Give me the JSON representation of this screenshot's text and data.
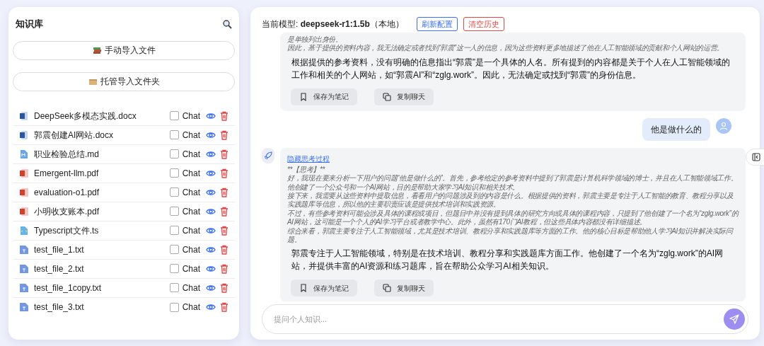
{
  "sidebar": {
    "title": "知识库",
    "import_buttons": [
      {
        "label": "手动导入文件",
        "kind": "books"
      },
      {
        "label": "托管导入文件夹",
        "kind": "box"
      }
    ],
    "files": [
      {
        "name": "DeepSeek多模态实践.docx",
        "kind": "word",
        "chat_label": "Chat",
        "checked": false
      },
      {
        "name": "郭震创建AI网站.docx",
        "kind": "word",
        "chat_label": "Chat",
        "checked": false
      },
      {
        "name": "职业检验总结.md",
        "kind": "md",
        "chat_label": "Chat",
        "checked": false
      },
      {
        "name": "Emergent-llm.pdf",
        "kind": "pdf",
        "chat_label": "Chat",
        "checked": false
      },
      {
        "name": "evaluation-o1.pdf",
        "kind": "pdf",
        "chat_label": "Chat",
        "checked": false
      },
      {
        "name": "小明收支账本.pdf",
        "kind": "pdf",
        "chat_label": "Chat",
        "checked": false
      },
      {
        "name": "Typescript文件.ts",
        "kind": "code",
        "chat_label": "Chat",
        "checked": false
      },
      {
        "name": "test_file_1.txt",
        "kind": "txt",
        "chat_label": "Chat",
        "checked": false
      },
      {
        "name": "test_file_2.txt",
        "kind": "txt",
        "chat_label": "Chat",
        "checked": false
      },
      {
        "name": "test_file_1copy.txt",
        "kind": "txt",
        "chat_label": "Chat",
        "checked": false
      },
      {
        "name": "test_file_3.txt",
        "kind": "txt",
        "chat_label": "Chat",
        "checked": false
      }
    ]
  },
  "chat": {
    "model_line": "当前模型: **deepseek-r1:1.5b**（本地）",
    "header_buttons": [
      {
        "label": "刷新配置",
        "kind": "primary"
      },
      {
        "label": "清空历史",
        "kind": "danger"
      }
    ],
    "messages": [
      {
        "kind": "bot",
        "thinking": [
          "是单独列出身份。",
          "因此，基于提供的资料内容，我无法确定或者找到“郭震”这一人的信息，因为这些资料更多地描述了他在人工智能领域的贡献和个人网站的运营。"
        ],
        "answer": "根据提供的参考资料，没有明确的信息指出“郭震”是一个具体的人名。所有提到的内容都是关于个人在人工智能领域的工作和相关的个人网站，如“郭震AI”和“zglg.work”。因此，无法确定或找到“郭震”的身份信息。",
        "actions": [
          {
            "label": "保存为笔记",
            "kind": "bookmark"
          },
          {
            "label": "复制聊天",
            "kind": "copy"
          }
        ]
      },
      {
        "kind": "user",
        "text": "他是做什么的"
      },
      {
        "kind": "bot",
        "toggle": "隐藏思考过程",
        "thinking": [
          "**【思考】**",
          "好，我现在要来分析一下用户的问题“他是做什么的”。首先，参考给定的参考资料中提到了郭震是计算机科学领域的博士，并且在人工智能领域工作。他创建了一个公众号和一个AI网站，目的是帮助大家学习AI知识和相关技术。",
          "接下来，我需要从这些资料中提取信息，看看用户的问题涉及到的内容是什么。根据提供的资料，郭震主要是专注于人工智能的教育、教程分享以及实践题库等信息，所以他的主要职责应该是提供技术培训和实践资源。",
          "不过，有些参考资料可能会涉及具体的课程或项目，但题目中并没有提到具体的研究方向或具体的课程内容，只提到了他创建了一个名为“zglg.work”的AI网站，这可能是一个个人的AI学习平台或者教学中心。此外，虽然有170门AI教程，但这些具体内容都没有详细描述。",
          "综合来看，郭震主要专注于人工智能领域，尤其是技术培训、教程分享和实践题库等方面的工作。他的核心目标是帮助他人学习AI知识并解决实际问题。"
        ],
        "answer": "郭震专注于人工智能领域，特别是在技术培训、教程分享和实践题库方面工作。他创建了一个名为“zglg.work”的AI网站，并提供丰富的AI资源和练习题库，旨在帮助公众学习AI相关知识。",
        "actions": [
          {
            "label": "保存为笔记",
            "kind": "bookmark"
          },
          {
            "label": "复制聊天",
            "kind": "copy"
          }
        ]
      }
    ],
    "input": {
      "placeholder": "提问个人知识..."
    }
  }
}
